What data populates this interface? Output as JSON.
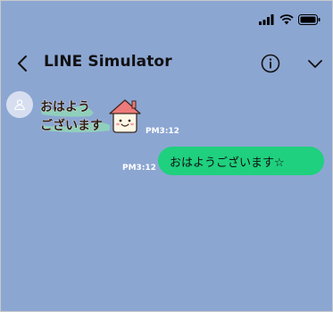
{
  "status_bar": {
    "icons": [
      "signal-icon",
      "wifi-icon",
      "battery-icon"
    ]
  },
  "header": {
    "title": "LINE Simulator",
    "icons": [
      "back-arrow-icon",
      "info-icon",
      "chevron-down-icon"
    ]
  },
  "messages": [
    {
      "side": "received",
      "kind": "sticker",
      "sticker_text_line1": "おはよう",
      "sticker_text_line2": "ございます",
      "time": "PM3:12"
    },
    {
      "side": "sent",
      "kind": "text",
      "text": "おはようございます☆",
      "time": "PM3:12"
    }
  ],
  "colors": {
    "background": "#8ca6d2",
    "sent_bubble": "#1fd07e",
    "timestamp": "#ffffff",
    "avatar": "#d6def0"
  }
}
